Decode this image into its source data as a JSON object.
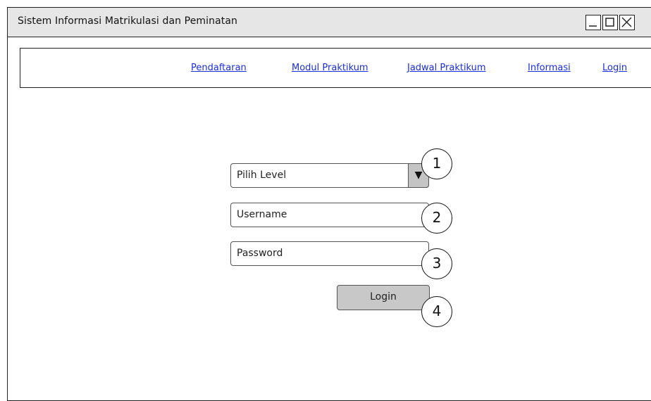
{
  "window": {
    "title": "Sistem Informasi Matrikulasi dan Peminatan",
    "controls": [
      "minimize",
      "maximize",
      "close"
    ]
  },
  "nav": {
    "items": [
      {
        "label": "Pendaftaran"
      },
      {
        "label": "Modul Praktikum"
      },
      {
        "label": "Jadwal Praktikum"
      },
      {
        "label": "Informasi"
      },
      {
        "label": "Login"
      }
    ]
  },
  "form": {
    "level_select": {
      "value": "Pilih Level",
      "arrow": "▼"
    },
    "username": {
      "value": "Username"
    },
    "password": {
      "value": "Password"
    },
    "login_button": "Login"
  },
  "markers": [
    "1",
    "2",
    "3",
    "4"
  ]
}
